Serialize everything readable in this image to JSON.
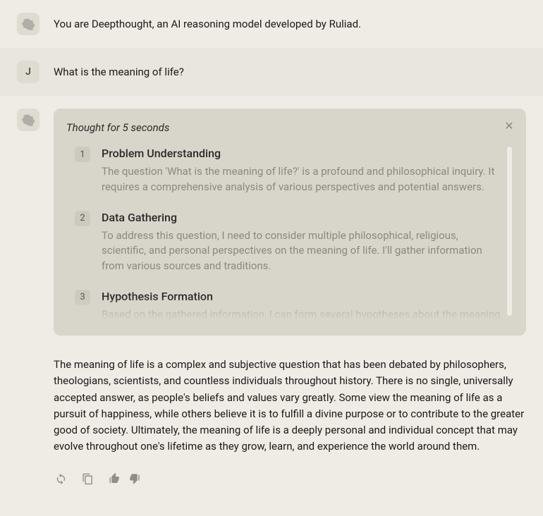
{
  "messages": {
    "system": {
      "text": "You are Deepthought, an AI reasoning model developed by Ruliad."
    },
    "user": {
      "avatar_letter": "J",
      "text": "What is the meaning of life?"
    },
    "assistant": {
      "thought_header": "Thought for 5 seconds",
      "steps": [
        {
          "num": "1",
          "title": "Problem Understanding",
          "desc": "The question 'What is the meaning of life?' is a profound and philosophical inquiry. It requires a comprehensive analysis of various perspectives and potential answers."
        },
        {
          "num": "2",
          "title": "Data Gathering",
          "desc": "To address this question, I need to consider multiple philosophical, religious, scientific, and personal perspectives on the meaning of life. I'll gather information from various sources and traditions."
        },
        {
          "num": "3",
          "title": "Hypothesis Formation",
          "desc": "Based on the gathered information, I can form several hypotheses about the meaning of"
        }
      ],
      "answer": "The meaning of life is a complex and subjective question that has been debated by philosophers, theologians, scientists, and countless individuals throughout history. There is no single, universally accepted answer, as people's beliefs and values vary greatly. Some view the meaning of life as a pursuit of happiness, while others believe it is to fulfill a divine purpose or to contribute to the greater good of society. Ultimately, the meaning of life is a deeply personal and individual concept that may evolve throughout one's lifetime as they grow, learn, and experience the world around them."
    }
  },
  "icons": {
    "refresh": "refresh-icon",
    "copy": "copy-icon",
    "thumbs_up": "thumbs-up-icon",
    "thumbs_down": "thumbs-down-icon",
    "close": "close-icon",
    "ai_logo": "ai-logo-icon"
  }
}
